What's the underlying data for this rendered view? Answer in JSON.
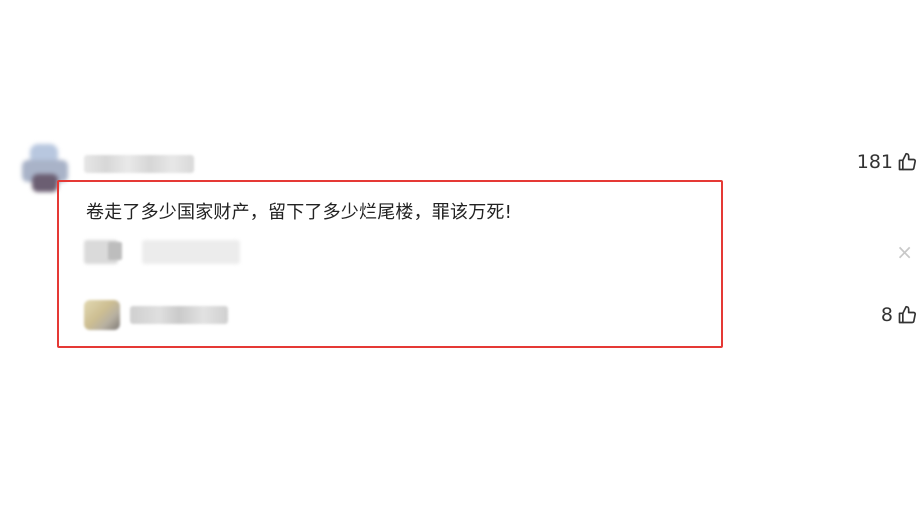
{
  "comment": {
    "text": "卷走了多少国家财产，留下了多少烂尾楼，罪该万死!",
    "like_count": "181"
  },
  "reply": {
    "like_count": "8"
  },
  "icons": {
    "like": "thumbs-up-icon",
    "close": "close-icon"
  },
  "colors": {
    "highlight_border": "#e53935"
  }
}
